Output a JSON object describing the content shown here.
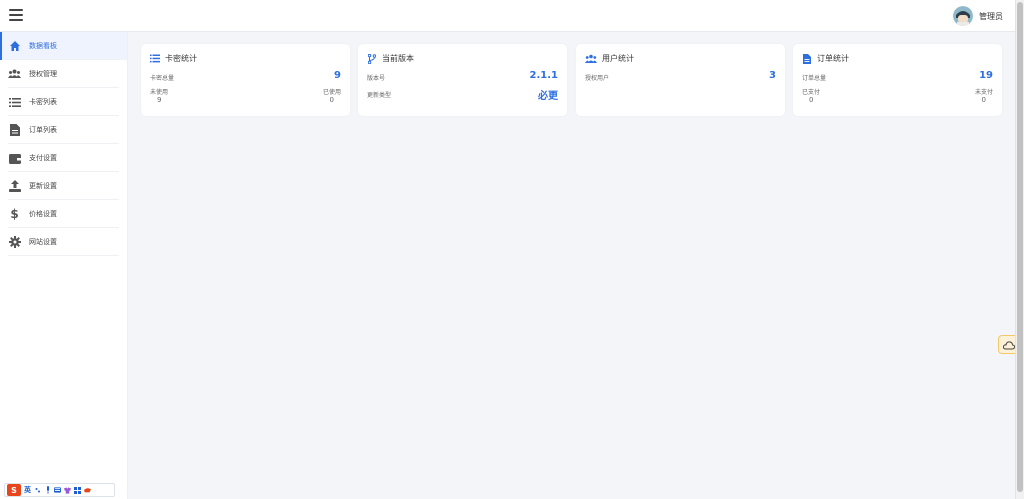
{
  "header": {
    "username": "管理员"
  },
  "sidebar": {
    "items": [
      {
        "label": "数据看板",
        "icon": "home-icon"
      },
      {
        "label": "授权管理",
        "icon": "users-icon"
      },
      {
        "label": "卡密列表",
        "icon": "list-icon"
      },
      {
        "label": "订单列表",
        "icon": "file-icon"
      },
      {
        "label": "支付设置",
        "icon": "wallet-icon"
      },
      {
        "label": "更新设置",
        "icon": "upload-icon"
      },
      {
        "label": "价格设置",
        "icon": "dollar-icon"
      },
      {
        "label": "网站设置",
        "icon": "gear-icon"
      }
    ]
  },
  "cards": {
    "cardkeys": {
      "title": "卡密统计",
      "total_label": "卡密总量",
      "total_value": "9",
      "unused_label": "未使用",
      "unused_value": "9",
      "used_label": "已使用",
      "used_value": "0"
    },
    "version": {
      "title": "当前版本",
      "version_label": "版本号",
      "version_value": "2.1.1",
      "type_label": "更新类型",
      "type_value": "必更"
    },
    "users": {
      "title": "用户统计",
      "authorized_label": "授权用户",
      "authorized_value": "3"
    },
    "orders": {
      "title": "订单统计",
      "total_label": "订单总量",
      "total_value": "19",
      "paid_label": "已支付",
      "paid_value": "0",
      "unpaid_label": "未支付",
      "unpaid_value": "0"
    }
  },
  "ime": {
    "logo": "S",
    "lang": "英"
  },
  "colors": {
    "accent": "#2e6fe0",
    "background": "#f3f5f8"
  }
}
